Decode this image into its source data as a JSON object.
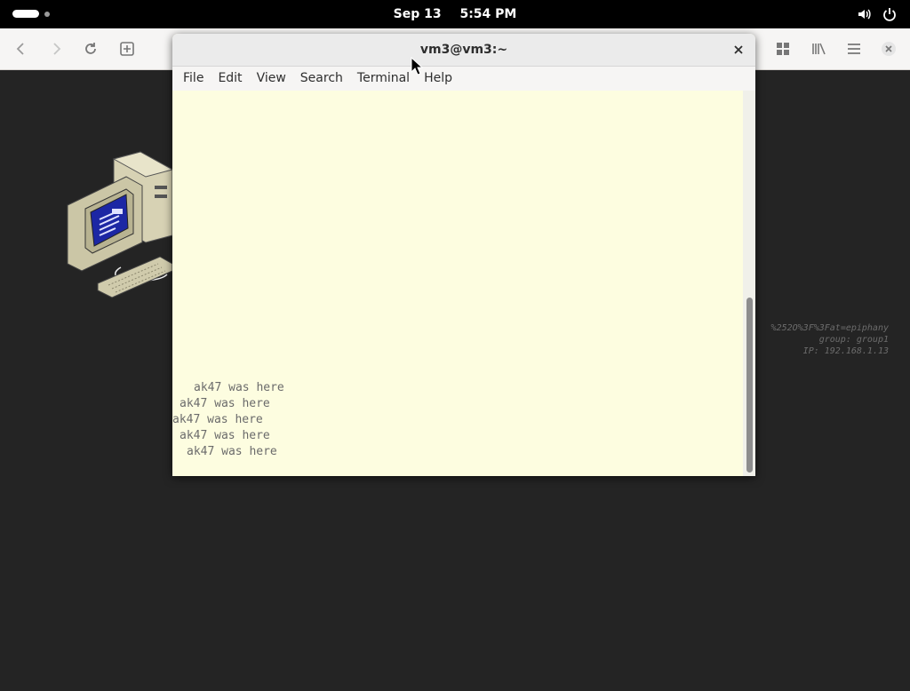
{
  "topbar": {
    "date": "Sep 13",
    "time": "5:54 PM",
    "tray_icons": [
      "volume-icon",
      "power-icon"
    ]
  },
  "browser": {
    "nav_icons": [
      "back-icon",
      "forward-icon",
      "reload-icon",
      "new-tab-icon"
    ],
    "right_icons": [
      "tab-overview-icon",
      "library-icon",
      "menu-icon",
      "close-icon"
    ]
  },
  "desktop": {
    "watermark_lines": [
      "%252O%3F%3Fat=epiphany",
      "group: group1",
      "IP: 192.168.1.13"
    ]
  },
  "terminal": {
    "title": "vm3@vm3:~",
    "menu": [
      "File",
      "Edit",
      "View",
      "Search",
      "Terminal",
      "Help"
    ],
    "lines": [
      "ak47 was here",
      "ak47 was here",
      "ak47 was here",
      "ak47 was here",
      "ak47 was here"
    ],
    "scroll_position": 0.9
  },
  "colors": {
    "terminal_bg": "#fdfde0",
    "desktop_bg": "#242424",
    "topbar_bg": "#000000"
  }
}
